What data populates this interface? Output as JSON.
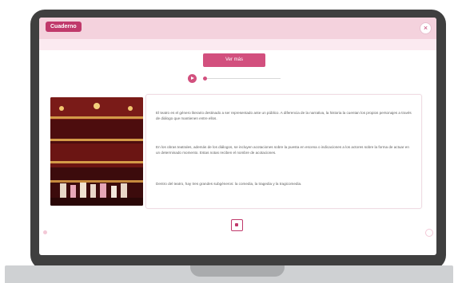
{
  "header": {
    "brand_label": "Cuaderno",
    "close_label": "×"
  },
  "main": {
    "action_label": "Ver más",
    "audio": {
      "progress": 0.0
    },
    "image_alt": "Teatro",
    "paragraphs": [
      "El teatro es el género literario destinado a ser representado ante un público. A diferencia de la narrativa, la historia la cuentan los propios personajes a través de diálogo que mantienen entre ellos.",
      "En los obras teatrales, además de los diálogos, se incluyen acotaciones sobre la puesta en escena o indicaciones a los actores sobre la forma de actuar en un determinado momento. Estas notas reciben el nombre de acotaciones.",
      "Dentro del teatro, hay tres grandes subgéneros: la comedia, la tragedia y la tragicomedia."
    ]
  },
  "colors": {
    "accent": "#d2507e",
    "header_bg": "#f4d2dd",
    "bezel": "#3f3f3f"
  },
  "icons": {
    "close": "close-icon",
    "play": "play-icon",
    "center": "expand-icon"
  }
}
